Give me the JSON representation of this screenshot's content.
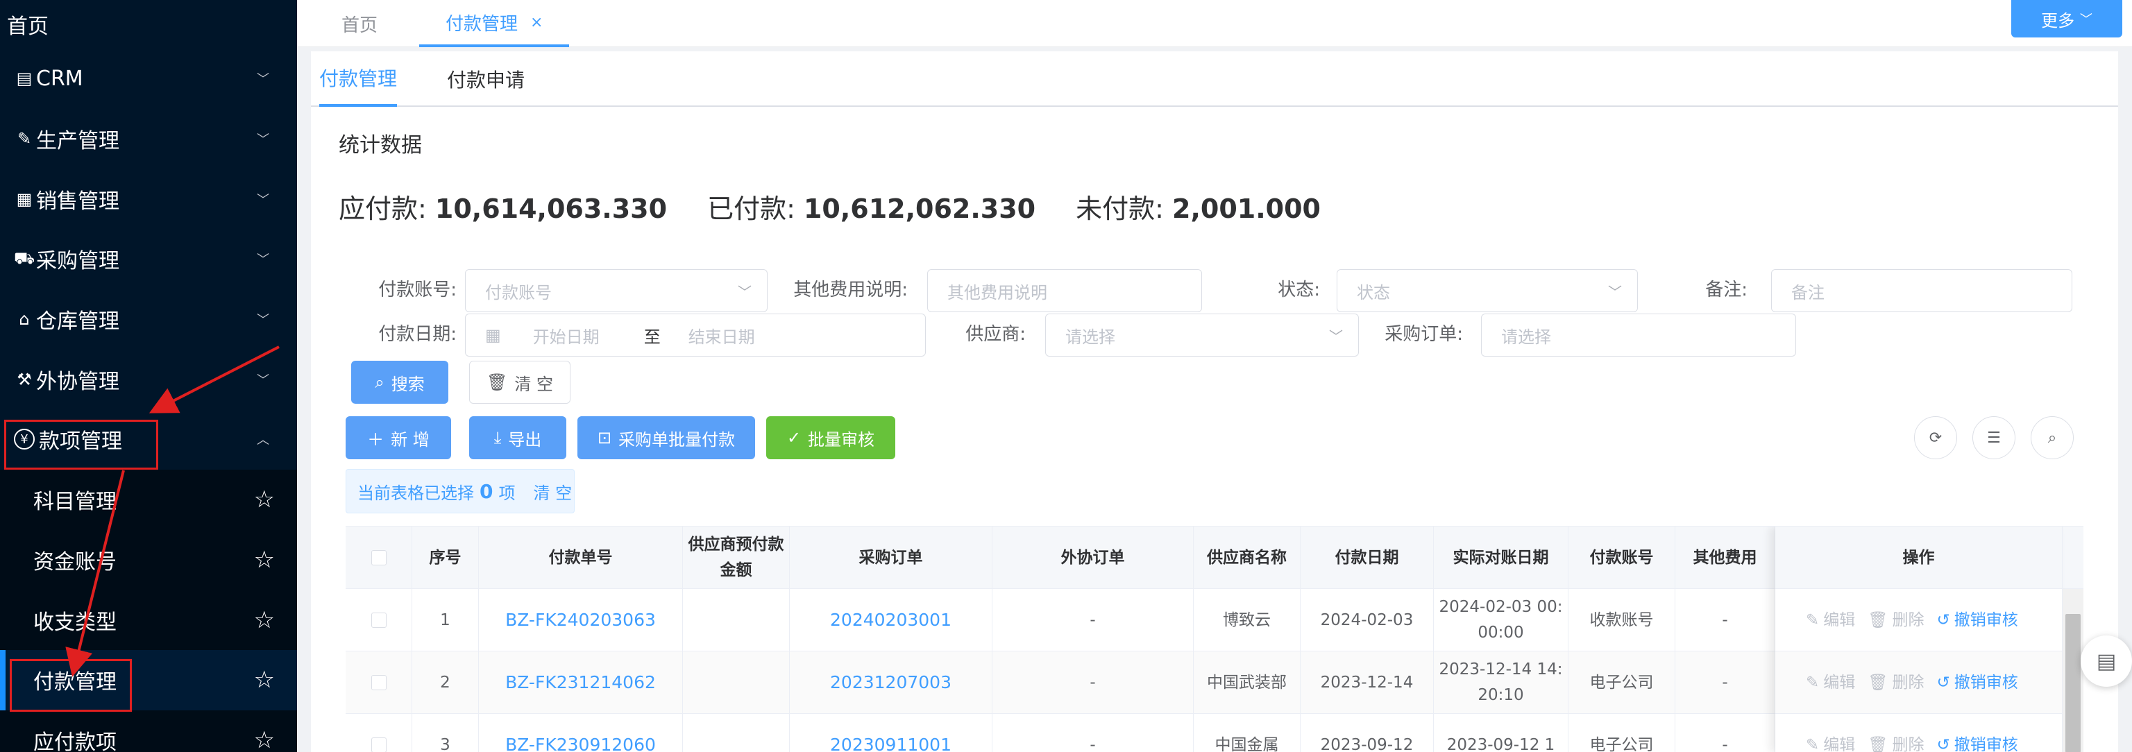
{
  "sidebar": {
    "home": "首页",
    "items": [
      {
        "label": "CRM",
        "icon": "form-icon",
        "glyph": "▤"
      },
      {
        "label": "生产管理",
        "icon": "production-icon",
        "glyph": "✎"
      },
      {
        "label": "销售管理",
        "icon": "sales-icon",
        "glyph": "▦"
      },
      {
        "label": "采购管理",
        "icon": "cart-icon",
        "glyph": "⛟"
      },
      {
        "label": "仓库管理",
        "icon": "warehouse-icon",
        "glyph": "⌂"
      },
      {
        "label": "外协管理",
        "icon": "outsource-icon",
        "glyph": "⚒"
      },
      {
        "label": "款项管理",
        "icon": "yuan-icon",
        "glyph": "¥"
      }
    ],
    "subitems": [
      "科目管理",
      "资金账号",
      "收支类型",
      "付款管理",
      "应付款项"
    ]
  },
  "tabs": {
    "home": "首页",
    "active": "付款管理",
    "close": "×",
    "more": "更多"
  },
  "subtabs": [
    "付款管理",
    "付款申请"
  ],
  "stats": {
    "title": "统计数据",
    "payable_label": "应付款:",
    "payable_value": "10,614,063.330",
    "paid_label": "已付款:",
    "paid_value": "10,612,062.330",
    "unpaid_label": "未付款:",
    "unpaid_value": "2,001.000"
  },
  "filters": {
    "account_label": "付款账号:",
    "account_placeholder": "付款账号",
    "other_fee_label": "其他费用说明:",
    "other_fee_placeholder": "其他费用说明",
    "status_label": "状态:",
    "status_placeholder": "状态",
    "remark_label": "备注:",
    "remark_placeholder": "备注",
    "date_label": "付款日期:",
    "date_start": "开始日期",
    "date_to": "至",
    "date_end": "结束日期",
    "supplier_label": "供应商:",
    "supplier_placeholder": "请选择",
    "po_label": "采购订单:",
    "po_placeholder": "请选择"
  },
  "buttons": {
    "search": "搜索",
    "clear": "清 空",
    "add": "新 增",
    "export": "导出",
    "batch_pay": "采购单批量付款",
    "batch_audit": "批量审核"
  },
  "selection": {
    "prefix": "当前表格已选择",
    "count": "0",
    "suffix": "项",
    "clear": "清 空"
  },
  "table": {
    "headers": [
      "序号",
      "付款单号",
      "供应商预付款金额",
      "采购订单",
      "外协订单",
      "供应商名称",
      "付款日期",
      "实际对账日期",
      "付款账号",
      "其他费用",
      "操作"
    ],
    "rows": [
      {
        "no": "1",
        "code": "BZ-FK240203063",
        "prepay": "",
        "po": "20240203001",
        "outsource": "-",
        "supplier": "博致云",
        "date": "2024-02-03",
        "actual": "2024-02-03 00:00:00",
        "account": "收款账号",
        "other": "-"
      },
      {
        "no": "2",
        "code": "BZ-FK231214062",
        "prepay": "",
        "po": "20231207003",
        "outsource": "-",
        "supplier": "中国武装部",
        "date": "2023-12-14",
        "actual": "2023-12-14 14:20:10",
        "account": "电子公司",
        "other": "-"
      },
      {
        "no": "3",
        "code": "BZ-FK230912060",
        "prepay": "",
        "po": "20230911001",
        "outsource": "-",
        "supplier": "中国金属",
        "date": "2023-09-12",
        "actual": "2023-09-12 1",
        "account": "电子公司",
        "other": "-"
      }
    ],
    "ops": {
      "edit": "编辑",
      "delete": "删除",
      "revoke": "撤销审核"
    }
  }
}
